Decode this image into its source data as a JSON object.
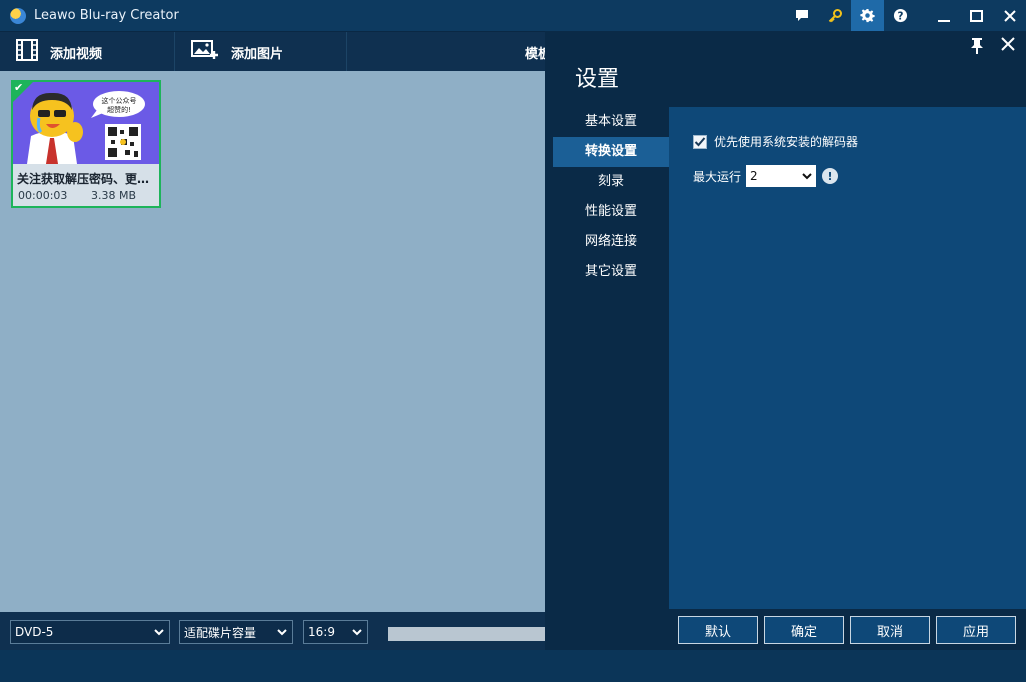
{
  "app": {
    "title": "Leawo Blu-ray Creator"
  },
  "toolbar": {
    "add_video": "添加视频",
    "add_image": "添加图片",
    "template": "模板"
  },
  "media": {
    "items": [
      {
        "title": "关注获取解压密码、更多资源",
        "duration": "00:00:03",
        "size": "3.38 MB",
        "thumb_bubble": "这个公众号超赞的!",
        "selected": true
      }
    ]
  },
  "bottom": {
    "disc_type": "DVD-5",
    "fit_mode": "适配碟片容量",
    "aspect_ratio": "16:9"
  },
  "settings": {
    "title": "设置",
    "nav": [
      {
        "label": "基本设置",
        "active": false
      },
      {
        "label": "转换设置",
        "active": true
      },
      {
        "label": "刻录",
        "active": false
      },
      {
        "label": "性能设置",
        "active": false
      },
      {
        "label": "网络连接",
        "active": false
      },
      {
        "label": "其它设置",
        "active": false
      }
    ],
    "prefer_system_decoder_label": "优先使用系统安装的解码器",
    "prefer_system_decoder_checked": true,
    "max_run_label": "最大运行",
    "max_run_value": "2",
    "buttons": {
      "default": "默认",
      "ok": "确定",
      "cancel": "取消",
      "apply": "应用"
    }
  },
  "colors": {
    "accent": "#1b5f96",
    "selected_border": "#1db45a",
    "content_bg": "#0e4878"
  }
}
